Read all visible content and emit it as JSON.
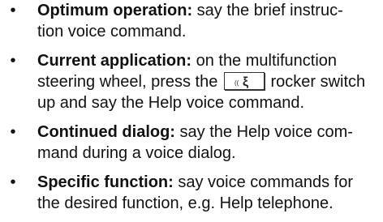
{
  "items": [
    {
      "bold": "Optimum operation:",
      "text_lines": [
        "say the brief instruc-",
        "tion voice command."
      ]
    },
    {
      "bold": "Current application:",
      "text_lines": [
        "on the multifunction",
        "steering wheel, press the",
        "rocker switch",
        "up and say the Help voice command."
      ],
      "icon": "voice-control-button-icon"
    },
    {
      "bold": "Continued dialog:",
      "text_lines": [
        "say the Help voice com-",
        "mand during a voice dialog."
      ]
    },
    {
      "bold": "Specific function:",
      "text_lines": [
        "say voice commands for",
        "the desired function, e.g. Help telephone."
      ]
    }
  ]
}
